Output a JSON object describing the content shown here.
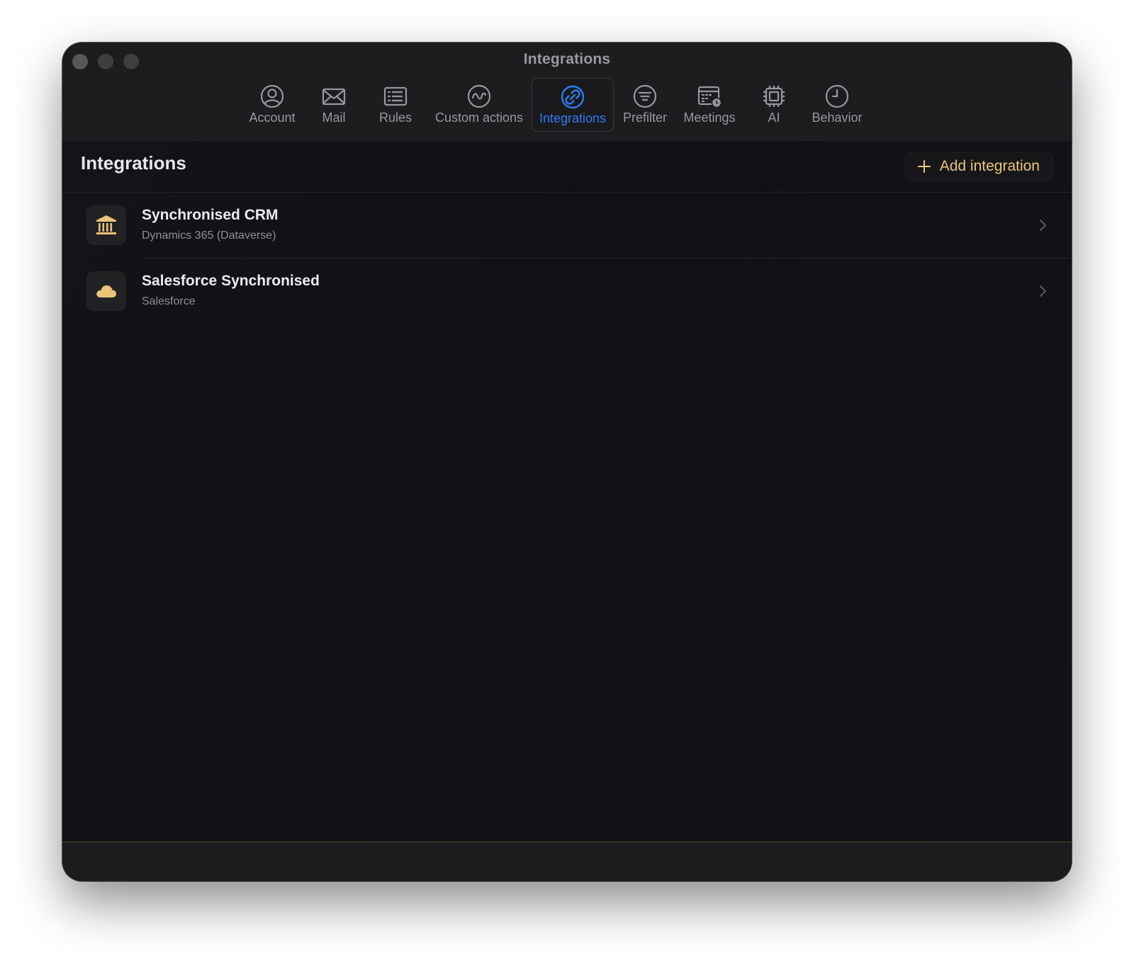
{
  "window": {
    "title": "Integrations"
  },
  "tabs": [
    {
      "label": "Account",
      "icon": "person-circle-icon"
    },
    {
      "label": "Mail",
      "icon": "envelope-icon"
    },
    {
      "label": "Rules",
      "icon": "list-icon"
    },
    {
      "label": "Custom actions",
      "icon": "waveform-circle-icon"
    },
    {
      "label": "Integrations",
      "icon": "link-circle-icon",
      "active": true
    },
    {
      "label": "Prefilter",
      "icon": "filter-circle-icon"
    },
    {
      "label": "Meetings",
      "icon": "calendar-clock-icon"
    },
    {
      "label": "AI",
      "icon": "cpu-icon"
    },
    {
      "label": "Behavior",
      "icon": "clock-icon"
    }
  ],
  "page": {
    "title": "Integrations",
    "add_button_label": "Add integration"
  },
  "integrations": [
    {
      "title": "Synchronised CRM",
      "subtitle": "Dynamics 365 (Dataverse)",
      "icon": "bank-building-icon"
    },
    {
      "title": "Salesforce Synchronised",
      "subtitle": "Salesforce",
      "icon": "cloud-icon"
    }
  ],
  "colors": {
    "accent_blue": "#2f7bf5",
    "accent_gold": "#e9c57a",
    "window_bg": "#131317",
    "titlebar_bg": "#1d1d20"
  }
}
